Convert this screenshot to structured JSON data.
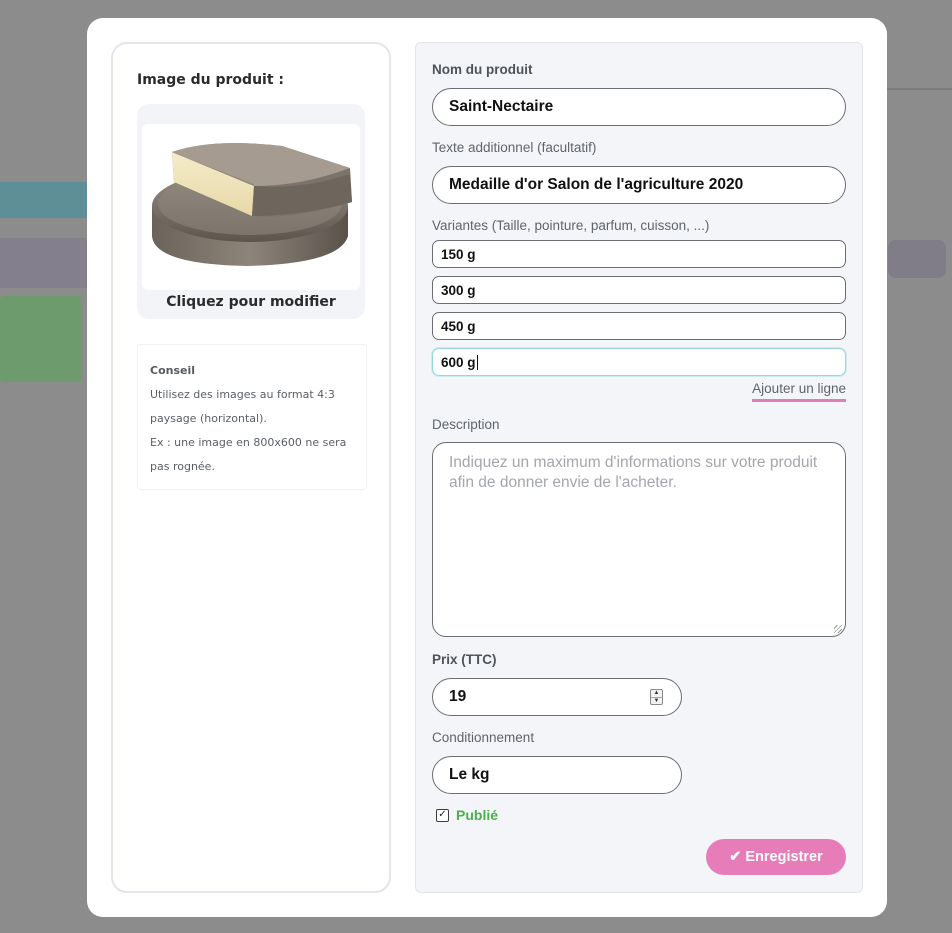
{
  "image_section": {
    "title": "Image du produit :",
    "caption": "Cliquez pour modifier"
  },
  "tip": {
    "title": "Conseil",
    "lines": [
      "Utilisez des images au format 4:3",
      "paysage (horizontal).",
      "Ex : une image en 800x600 ne sera",
      "pas rognée."
    ]
  },
  "form": {
    "name_label": "Nom du produit",
    "name_value": "Saint-Nectaire",
    "extra_label": "Texte additionnel (facultatif)",
    "extra_value": "Medaille d'or Salon de l'agriculture 2020",
    "variants_label": "Variantes (Taille, pointure, parfum, cuisson, ...)",
    "variants": [
      "150 g",
      "300 g",
      "450 g",
      "600 g"
    ],
    "add_line": "Ajouter un ligne",
    "description_label": "Description",
    "description_placeholder": "Indiquez un maximum d'informations sur votre produit afin de donner envie de l'acheter.",
    "price_label": "Prix (TTC)",
    "price_value": "19",
    "packaging_label": "Conditionnement",
    "packaging_value": "Le kg",
    "published_label": "Publié",
    "published_checked": true,
    "save_icon": "✔",
    "save_label": "Enregistrer"
  },
  "colors": {
    "accent_pink": "#e67db8",
    "published_green": "#4caf50",
    "focus_teal": "#9ad7dd"
  }
}
